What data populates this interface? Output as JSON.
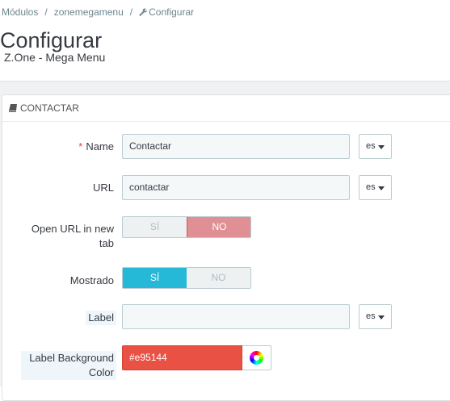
{
  "breadcrumb": {
    "items": [
      "Módulos",
      "zonemegamenu",
      "Configurar"
    ],
    "separator": "/"
  },
  "page": {
    "title": "Configurar",
    "subtitle": "Z.One - Mega Menu"
  },
  "panel": {
    "heading": "CONTACTAR",
    "heading_icon": "book-icon"
  },
  "form": {
    "name": {
      "label": "Name",
      "required_mark": "*",
      "value": "Contactar",
      "lang": "es"
    },
    "url": {
      "label": "URL",
      "value": "contactar",
      "lang": "es"
    },
    "open_url": {
      "label": "Open URL in new tab",
      "yes": "SÍ",
      "no": "NO",
      "selected": "no"
    },
    "mostrado": {
      "label": "Mostrado",
      "yes": "SÍ",
      "no": "NO",
      "selected": "yes"
    },
    "label": {
      "label": "Label",
      "value": "",
      "lang": "es"
    },
    "label_bg": {
      "label": "Label Background Color",
      "value": "#e95144",
      "picker_icon": "color-wheel-icon"
    }
  },
  "colors": {
    "accent": "#25b9d7",
    "switch_no_active": "#e08f95",
    "label_bg": "#e95144"
  }
}
